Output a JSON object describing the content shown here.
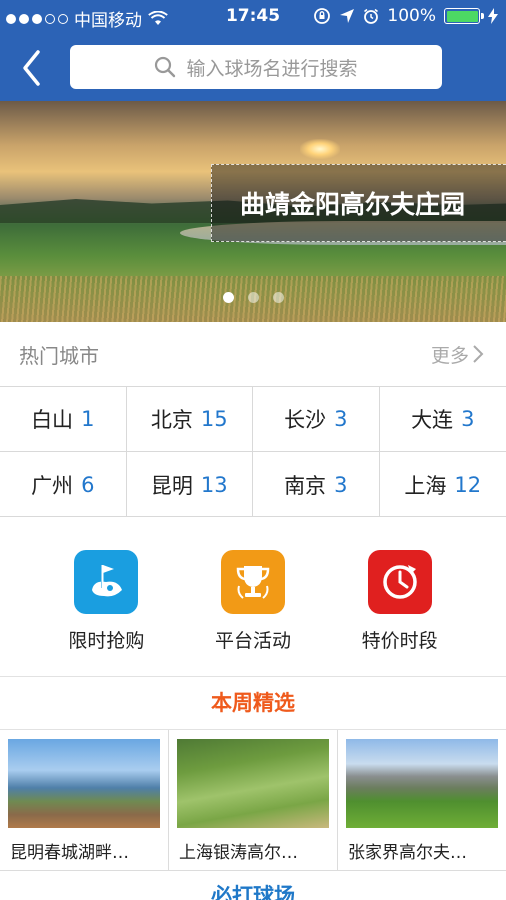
{
  "status_bar": {
    "carrier": "中国移动",
    "time": "17:45",
    "battery": "100%",
    "battery_level": 1.0,
    "signal_bars_filled": 3,
    "signal_bars_total": 5
  },
  "header": {
    "search_placeholder": "输入球场名进行搜索",
    "accent_color": "#2c63b6"
  },
  "banner": {
    "caption": "曲靖金阳高尔夫庄园",
    "page_count": 3,
    "active_page": 1
  },
  "hot_cities": {
    "title": "热门城市",
    "more_label": "更多",
    "items": [
      {
        "name": "白山",
        "count": "1"
      },
      {
        "name": "北京",
        "count": "15"
      },
      {
        "name": "长沙",
        "count": "3"
      },
      {
        "name": "大连",
        "count": "3"
      },
      {
        "name": "广州",
        "count": "6"
      },
      {
        "name": "昆明",
        "count": "13"
      },
      {
        "name": "南京",
        "count": "3"
      },
      {
        "name": "上海",
        "count": "12"
      }
    ]
  },
  "features": [
    {
      "label": "限时抢购",
      "icon": "golf-flag-icon",
      "color": "#1a9ee0"
    },
    {
      "label": "平台活动",
      "icon": "trophy-icon",
      "color": "#f29a16"
    },
    {
      "label": "特价时段",
      "icon": "clock-icon",
      "color": "#e0201f"
    }
  ],
  "weekly": {
    "title": "本周精选",
    "title_color": "#ef5a1c",
    "cards": [
      {
        "name": "昆明春城湖畔…"
      },
      {
        "name": "上海银涛高尔…"
      },
      {
        "name": "张家界高尔夫…"
      }
    ]
  },
  "next_section": {
    "title": "必打球场"
  }
}
